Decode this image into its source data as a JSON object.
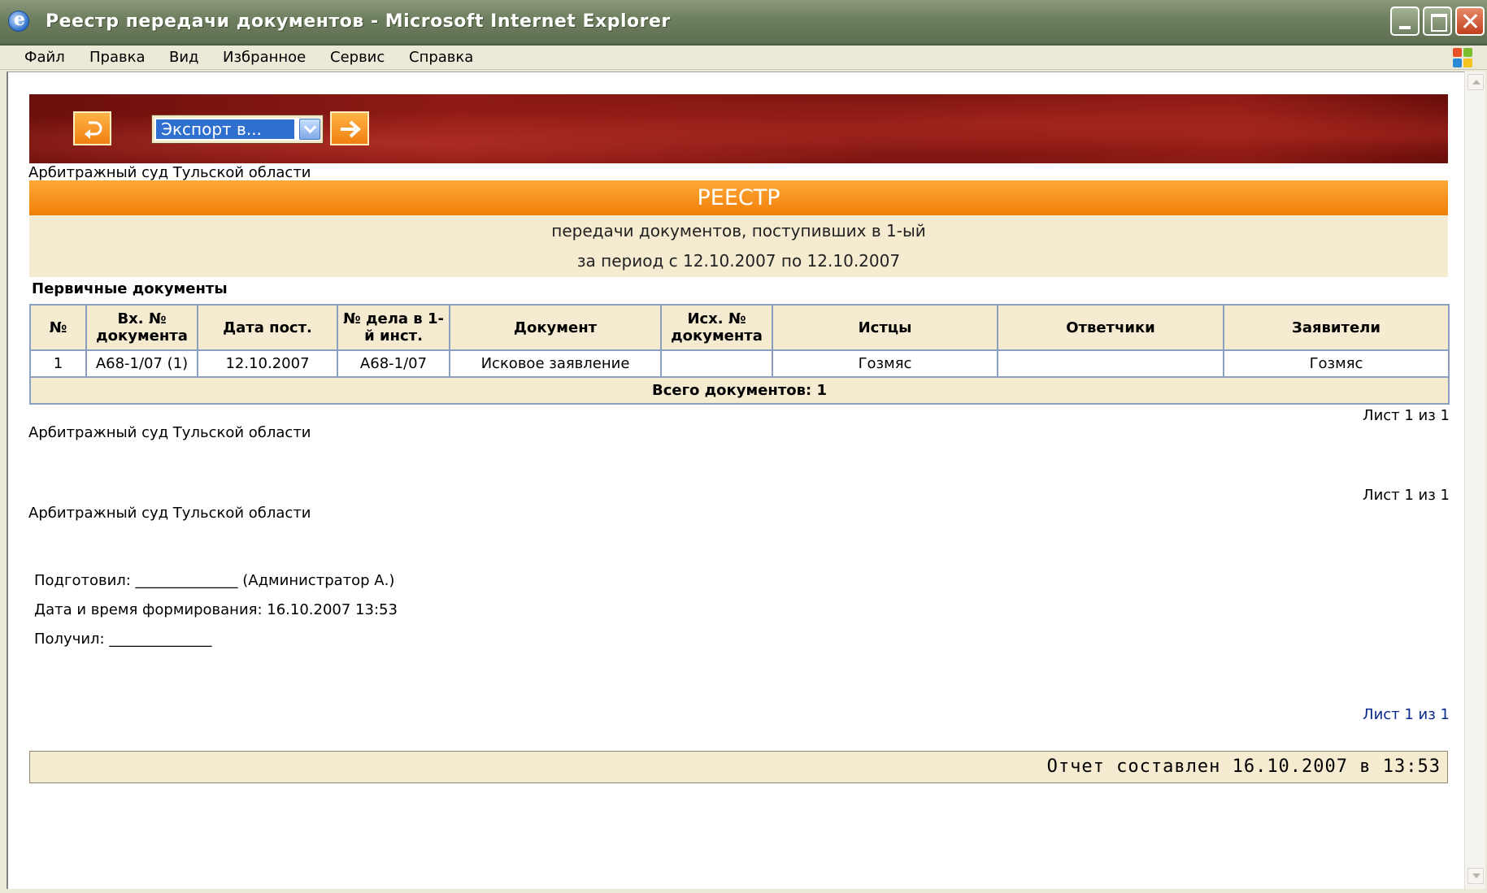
{
  "window": {
    "title": "Реестр передачи документов - Microsoft Internet Explorer"
  },
  "menu": [
    "Файл",
    "Правка",
    "Вид",
    "Избранное",
    "Сервис",
    "Справка"
  ],
  "toolbar": {
    "export_selected": "Экспорт в..."
  },
  "report": {
    "court_name": "Арбитражный суд Тульской области",
    "heading": "РЕЕСТР",
    "subtitle": "передачи документов, поступивших в 1-ый",
    "period": "за период с 12.10.2007 по 12.10.2007",
    "section_title": "Первичные документы",
    "table": {
      "headers": [
        "№",
        "Вх. № документа",
        "Дата пост.",
        "№ дела в 1-й инст.",
        "Документ",
        "Исх. № документа",
        "Истцы",
        "Ответчики",
        "Заявители"
      ],
      "rows": [
        [
          "1",
          "А68-1/07 (1)",
          "12.10.2007",
          "А68-1/07",
          "Исковое заявление",
          "",
          "Гозмяс",
          "",
          "Гозмяс"
        ]
      ],
      "total": "Всего документов: 1"
    },
    "sheet_label": "Лист 1 из 1",
    "prepared_by": "Подготовил: ______________ (Администратор А.)",
    "generated_at": "Дата и время формирования: 16.10.2007 13:53",
    "received_by": "Получил: ______________",
    "footer": "Отчет составлен 16.10.2007 в 13:53"
  },
  "colors": {
    "banner": "#7c140f",
    "accent_orange": "#f58a1a",
    "beige": "#f5ebd1",
    "table_border": "#8ba0c0",
    "link_blue": "#0a2a8a"
  },
  "icons": [
    "ie-icon",
    "minimize-icon",
    "maximize-icon",
    "close-icon",
    "windows-logo-icon",
    "refresh-icon",
    "dropdown-arrow-icon",
    "go-arrow-icon"
  ]
}
